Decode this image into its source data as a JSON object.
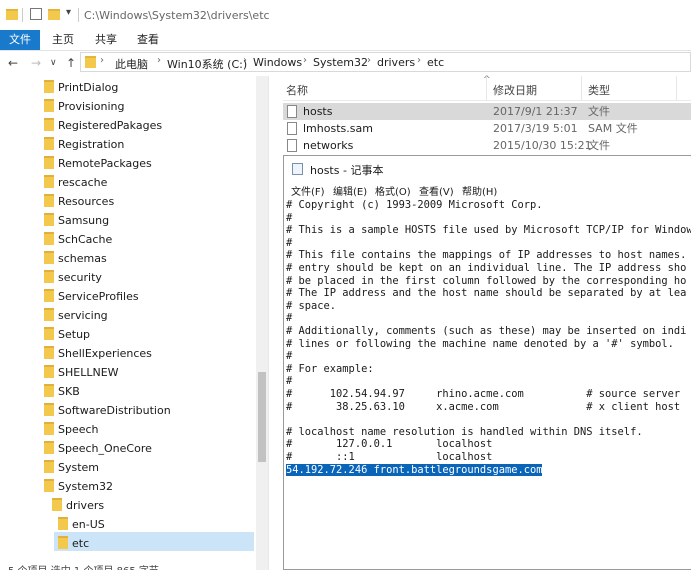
{
  "window": {
    "title_path": "C:\\Windows\\System32\\drivers\\etc"
  },
  "ribbon": {
    "tabs": [
      "文件",
      "主页",
      "共享",
      "查看"
    ]
  },
  "nav": {
    "back_glyph": "←",
    "forward_glyph": "→",
    "down_glyph": "∨",
    "up_glyph": "↑",
    "crumbs": [
      "此电脑",
      "Win10系统 (C:)",
      "Windows",
      "System32",
      "drivers",
      "etc"
    ]
  },
  "tree": {
    "items": [
      "PrintDialog",
      "Provisioning",
      "RegisteredPakages",
      "Registration",
      "RemotePackages",
      "rescache",
      "Resources",
      "Samsung",
      "SchCache",
      "schemas",
      "security",
      "ServiceProfiles",
      "servicing",
      "Setup",
      "ShellExperiences",
      "SHELLNEW",
      "SKB",
      "SoftwareDistribution",
      "Speech",
      "Speech_OneCore",
      "System",
      "System32"
    ],
    "sub_items": [
      "drivers",
      "en-US",
      "etc"
    ],
    "selected": "etc"
  },
  "filelist": {
    "headers": {
      "name": "名称",
      "date": "修改日期",
      "type": "类型",
      "sort_glyph": "^"
    },
    "rows": [
      {
        "name": "hosts",
        "date": "2017/9/1 21:37",
        "type": "文件"
      },
      {
        "name": "lmhosts.sam",
        "date": "2017/3/19 5:01",
        "type": "SAM 文件"
      },
      {
        "name": "networks",
        "date": "2015/10/30 15:21",
        "type": "文件"
      }
    ]
  },
  "notepad": {
    "title": "hosts - 记事本",
    "menu": [
      "文件(F)",
      "编辑(E)",
      "格式(O)",
      "查看(V)",
      "帮助(H)"
    ],
    "lines": [
      "# Copyright (c) 1993-2009 Microsoft Corp.",
      "#",
      "# This is a sample HOSTS file used by Microsoft TCP/IP for Window",
      "#",
      "# This file contains the mappings of IP addresses to host names.",
      "# entry should be kept on an individual line. The IP address sho",
      "# be placed in the first column followed by the corresponding ho",
      "# The IP address and the host name should be separated by at lea",
      "# space.",
      "#",
      "# Additionally, comments (such as these) may be inserted on indi",
      "# lines or following the machine name denoted by a '#' symbol.",
      "#",
      "# For example:",
      "#",
      "#      102.54.94.97     rhino.acme.com          # source server",
      "#       38.25.63.10     x.acme.com              # x client host",
      "",
      "# localhost name resolution is handled within DNS itself.",
      "#       127.0.0.1       localhost",
      "#       ::1             localhost"
    ],
    "highlighted_line": "54.192.72.246 front.battlegroundsgame.com"
  },
  "status": {
    "text": "5 个项目    选中 1 个项目  865 字节"
  },
  "colors": {
    "accent": "#1979ca",
    "selection": "#cce4f7",
    "text_highlight": "#0a64b8",
    "folder": "#f2c94c"
  }
}
